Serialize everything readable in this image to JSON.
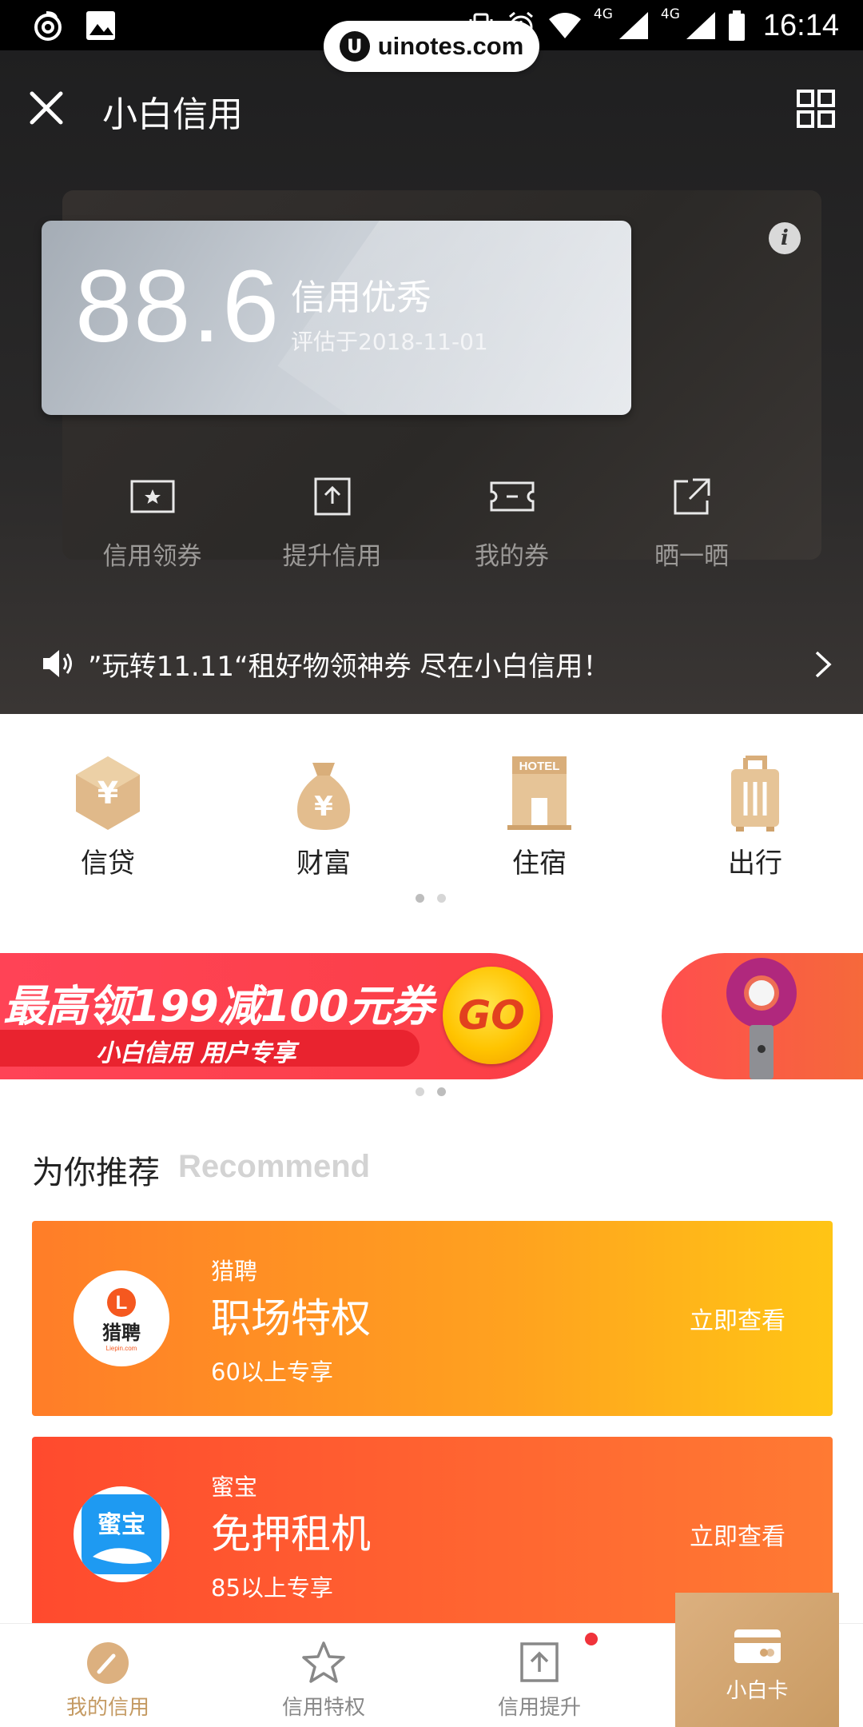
{
  "status_bar": {
    "time": "16:14",
    "network_1": "4G",
    "network_2": "4G"
  },
  "watermark": {
    "logo": "U",
    "text": "uinotes.com"
  },
  "header": {
    "title": "小白信用",
    "close_icon": "close-icon",
    "menu_icon": "grid-icon"
  },
  "credit_card": {
    "score": "88.6",
    "level": "信用优秀",
    "date": "评估于2018-11-01"
  },
  "quick_actions": [
    {
      "label": "信用领券",
      "icon": "ticket-star-icon"
    },
    {
      "label": "提升信用",
      "icon": "upload-icon"
    },
    {
      "label": "我的券",
      "icon": "coupon-icon"
    },
    {
      "label": "晒一晒",
      "icon": "share-icon"
    }
  ],
  "notice": {
    "text": "”玩转11.11“租好物领神券 尽在小白信用！"
  },
  "categories": [
    {
      "label": "信贷",
      "icon": "yen-hexagon-icon"
    },
    {
      "label": "财富",
      "icon": "money-bag-icon"
    },
    {
      "label": "住宿",
      "icon": "hotel-icon"
    },
    {
      "label": "出行",
      "icon": "luggage-icon"
    }
  ],
  "banner": {
    "title": "最高领199减100元券",
    "subtitle": "小白信用  用户专享",
    "go": "GO"
  },
  "recommend": {
    "title": "为你推荐",
    "title_en": "Recommend",
    "items": [
      {
        "brand": "猎聘",
        "name": "职场特权",
        "condition": "60以上专享",
        "action": "立即查看",
        "logo_text": "猎聘",
        "logo_sub": "Liepin.com"
      },
      {
        "brand": "蜜宝",
        "name": "免押租机",
        "condition": "85以上专享",
        "action": "立即查看",
        "logo_text": "蜜宝"
      }
    ]
  },
  "tabbar": [
    {
      "label": "我的信用",
      "icon": "gauge-icon",
      "active": true
    },
    {
      "label": "信用特权",
      "icon": "star-icon",
      "active": false
    },
    {
      "label": "信用提升",
      "icon": "upload-icon",
      "active": false
    },
    {
      "label": "小白卡",
      "icon": "card-icon",
      "active": false
    }
  ],
  "colors": {
    "accent_gold": "#c49a62",
    "banner_red": "#fb3f45",
    "card_orange": "#ff7d28"
  }
}
